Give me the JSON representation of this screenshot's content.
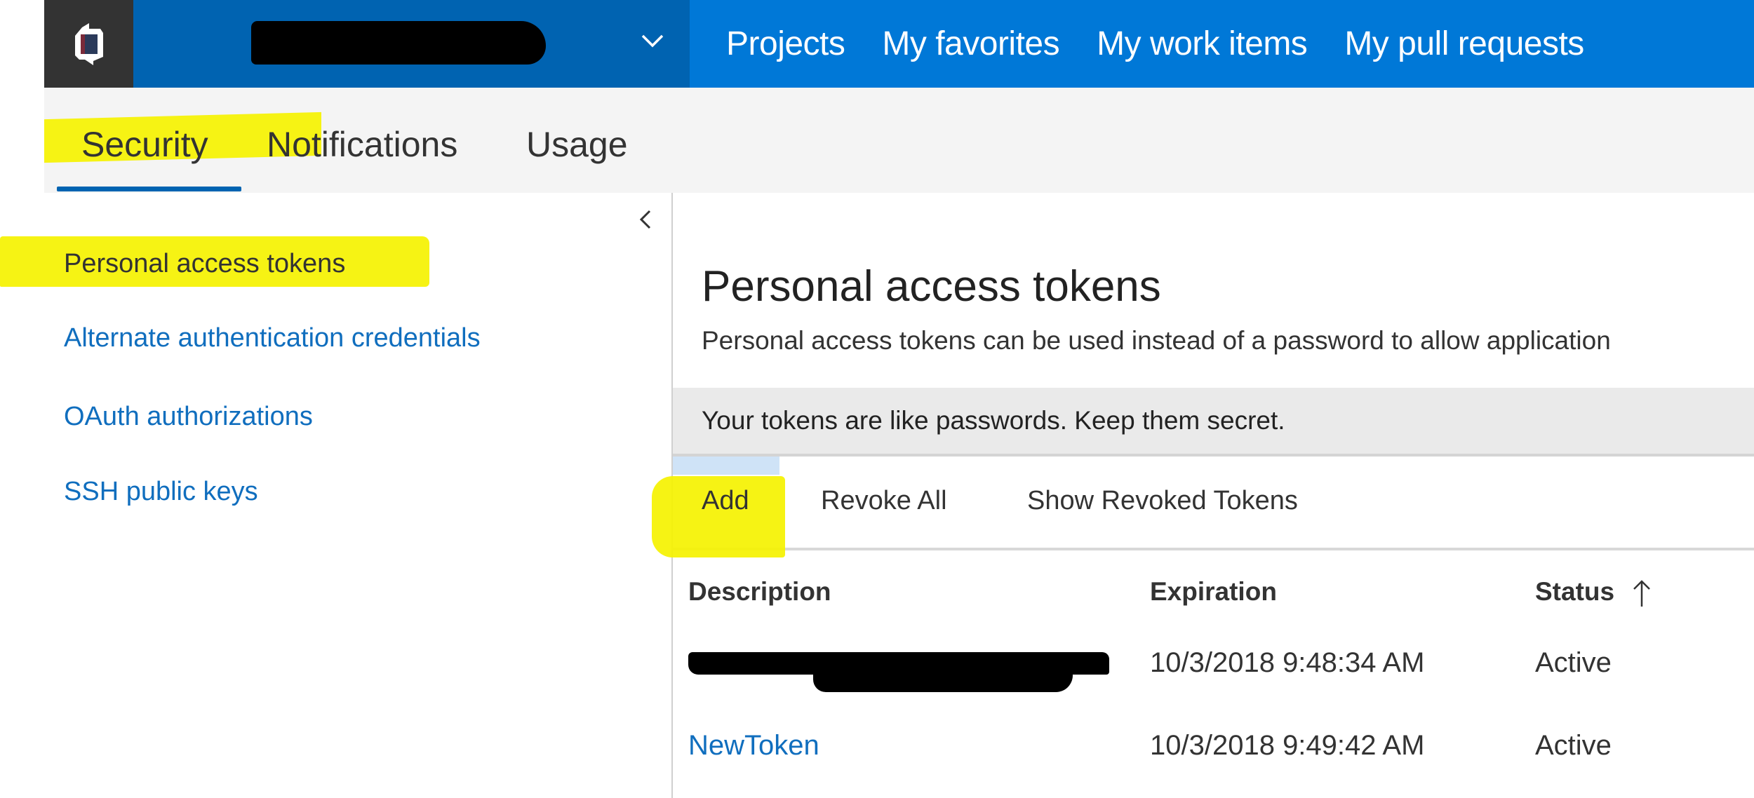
{
  "topbar": {
    "logo": "azure-devops-logo",
    "org_name_redacted": true,
    "nav": [
      "Projects",
      "My favorites",
      "My work items",
      "My pull requests"
    ]
  },
  "subtabs": {
    "items": [
      "Security",
      "Notifications",
      "Usage"
    ],
    "active": "Security"
  },
  "sidebar": {
    "collapse_icon": "chevron-left-icon",
    "items": [
      {
        "label": "Personal access tokens",
        "active": true
      },
      {
        "label": "Alternate authentication credentials",
        "active": false
      },
      {
        "label": "OAuth authorizations",
        "active": false
      },
      {
        "label": "SSH public keys",
        "active": false
      }
    ]
  },
  "main": {
    "title": "Personal access tokens",
    "description": "Personal access tokens can be used instead of a password to allow application",
    "warning": "Your tokens are like passwords. Keep them secret.",
    "toolbar": {
      "add": "Add",
      "revoke_all": "Revoke All",
      "show_revoked": "Show Revoked Tokens"
    },
    "table": {
      "columns": [
        "Description",
        "Expiration",
        "Status"
      ],
      "sort": {
        "column": "Status",
        "direction": "ascending",
        "icon": "arrow-up-icon"
      },
      "rows": [
        {
          "description": "[redacted]",
          "expiration": "10/3/2018 9:48:34 AM",
          "status": "Active"
        },
        {
          "description": "NewToken",
          "expiration": "10/3/2018 9:49:42 AM",
          "status": "Active"
        }
      ]
    }
  },
  "colors": {
    "nav_blue": "#0078d7",
    "org_blue": "#0063b1",
    "logo_tile": "#333333",
    "link_blue": "#106ebe",
    "highlight_yellow": "#f5f200",
    "subtab_bg": "#f4f4f4",
    "warning_bg": "#eaeaea"
  }
}
